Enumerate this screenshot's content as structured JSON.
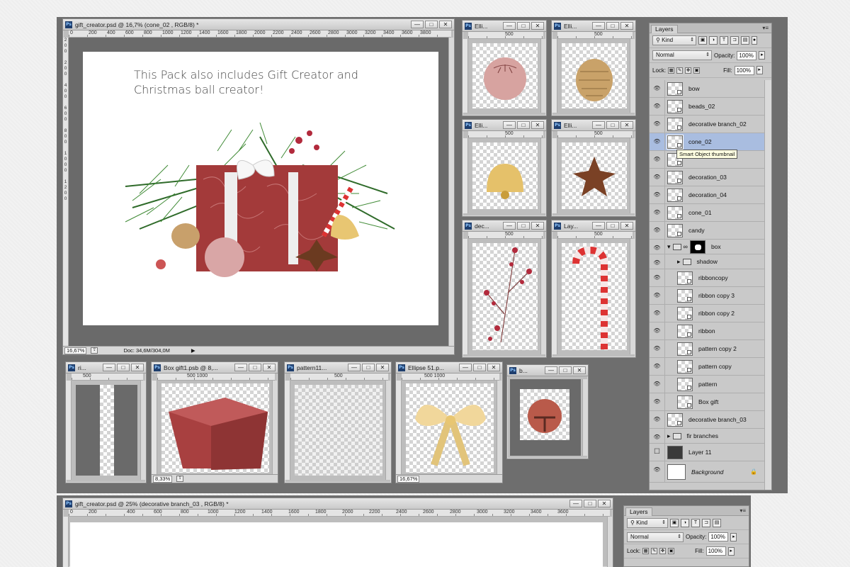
{
  "main_doc": {
    "title": "gift_creator.psd @ 16,7% (cone_02 , RGB/8) *",
    "ruler_h": [
      "0",
      "200",
      "400",
      "600",
      "800",
      "1000",
      "1200",
      "1400",
      "1600",
      "1800",
      "2000",
      "2200",
      "2400",
      "2600",
      "2800",
      "3000",
      "3200",
      "3400",
      "3600",
      "3800"
    ],
    "ruler_v": [
      "2",
      "0",
      "0",
      "2",
      "0",
      "0",
      "4",
      "0",
      "0",
      "6",
      "0",
      "0",
      "8",
      "0",
      "0",
      "1",
      "0",
      "0",
      "0",
      "1",
      "2",
      "0",
      "0",
      "1",
      "4",
      "0",
      "0"
    ],
    "promo_line1": "This Pack also includes Gift Creator and",
    "promo_line2": "Christmas ball creator!",
    "zoom": "16,67%",
    "doc_info": "Doc: 34,6M/304,0M"
  },
  "small_docs": [
    {
      "title": "Elli...",
      "ruler": "500"
    },
    {
      "title": "Elli...",
      "ruler": "500"
    },
    {
      "title": "Elli...",
      "ruler": "500"
    },
    {
      "title": "Elli...",
      "ruler": "500"
    },
    {
      "title": "dec...",
      "ruler": "500"
    },
    {
      "title": "Lay...",
      "ruler": "500"
    }
  ],
  "bottom_docs": [
    {
      "title": "ri...",
      "ruler": "500"
    },
    {
      "title": "Box gift1.psb @ 8,...",
      "ruler": "500    1000",
      "zoom": "8,33%"
    },
    {
      "title": "pattern11...",
      "ruler": "500"
    },
    {
      "title": "Ellipse 51.p...",
      "ruler": "500    1000",
      "zoom": "16,67%"
    },
    {
      "title": "b...",
      "ruler": ""
    }
  ],
  "second_doc": {
    "title": "gift_creator.psd @ 25% (decorative branch_03 , RGB/8) *",
    "ruler_h": [
      "0",
      "200",
      "400",
      "600",
      "800",
      "1000",
      "1200",
      "1400",
      "1600",
      "1800",
      "2000",
      "2200",
      "2400",
      "2600",
      "2800",
      "3000",
      "3200",
      "3400",
      "3600"
    ]
  },
  "win_buttons": {
    "minimize": "—",
    "restore": "□",
    "close": "✕"
  },
  "layers_panel": {
    "tab": "Layers",
    "kind": "Kind",
    "blend_mode": "Normal",
    "opacity_label": "Opacity:",
    "opacity": "100%",
    "lock_label": "Lock:",
    "fill_label": "Fill:",
    "fill": "100%",
    "tooltip": "Smart Object thumbnail",
    "layers": [
      {
        "name": "bow",
        "type": "smart",
        "indent": 0
      },
      {
        "name": "beads_02",
        "type": "smart",
        "indent": 0
      },
      {
        "name": "decorative branch_02",
        "type": "smart",
        "indent": 0
      },
      {
        "name": "cone_02",
        "type": "smart",
        "indent": 0,
        "selected": true
      },
      {
        "name": "",
        "type": "smart",
        "indent": 0
      },
      {
        "name": "decoration_03",
        "type": "smart",
        "indent": 0
      },
      {
        "name": "decoration_04",
        "type": "smart",
        "indent": 0
      },
      {
        "name": "cone_01",
        "type": "smart",
        "indent": 0
      },
      {
        "name": "candy",
        "type": "smart",
        "indent": 0
      },
      {
        "name": "box",
        "type": "group-open",
        "indent": 0
      },
      {
        "name": "shadow",
        "type": "group",
        "indent": 1
      },
      {
        "name": "ribboncopy",
        "type": "smart",
        "indent": 1
      },
      {
        "name": "ribbon copy 3",
        "type": "smart",
        "indent": 1
      },
      {
        "name": "ribbon copy 2",
        "type": "smart",
        "indent": 1
      },
      {
        "name": "ribbon",
        "type": "smart",
        "indent": 1
      },
      {
        "name": "pattern copy 2",
        "type": "smart",
        "indent": 1
      },
      {
        "name": "pattern copy",
        "type": "smart",
        "indent": 1
      },
      {
        "name": "pattern",
        "type": "smart",
        "indent": 1
      },
      {
        "name": "Box gift",
        "type": "smart",
        "indent": 1
      },
      {
        "name": "decorative branch_03",
        "type": "smart",
        "indent": 0
      },
      {
        "name": "fir branches",
        "type": "group",
        "indent": 0
      },
      {
        "name": "Layer 11",
        "type": "pixel",
        "indent": 0,
        "hidden": true
      },
      {
        "name": "Background",
        "type": "background",
        "indent": 0
      }
    ]
  },
  "layers_panel2": {
    "tab": "Layers",
    "kind": "Kind",
    "blend_mode": "Normal",
    "opacity_label": "Opacity:",
    "opacity": "100%",
    "lock_label": "Lock:",
    "fill_label": "Fill:",
    "fill": "100%"
  }
}
